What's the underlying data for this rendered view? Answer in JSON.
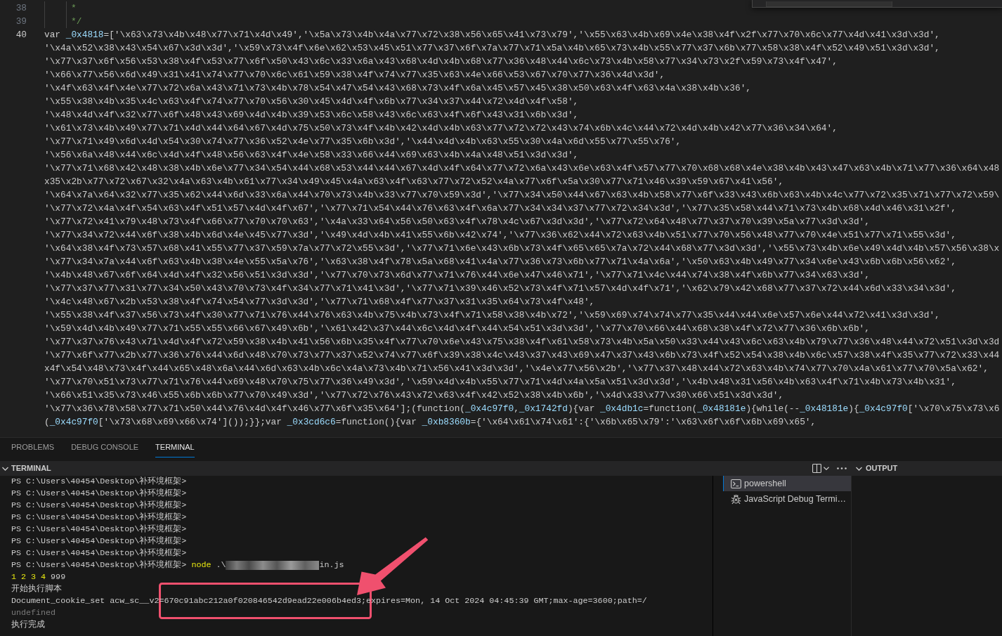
{
  "editor": {
    "lines": [
      {
        "number": "38",
        "current": false,
        "rows": [
          {
            "tokens": [
              {
                "kind": "comment",
                "text": "*"
              }
            ]
          }
        ]
      },
      {
        "number": "39",
        "current": false,
        "rows": [
          {
            "tokens": [
              {
                "kind": "comment",
                "text": "*/"
              }
            ]
          }
        ]
      },
      {
        "number": "40",
        "current": true,
        "rows": [
          {
            "tokens": [
              {
                "kind": "plain",
                "text": "var "
              },
              {
                "kind": "identifier",
                "text": "_0x4818"
              },
              {
                "kind": "plain",
                "text": "=['\\x63\\x73\\x4b\\x48\\x77\\x71\\x4d\\x49','\\x5a\\x73\\x4b\\x4a\\x77\\x72\\x38\\x56\\x65\\x41\\x73\\x79','\\x55\\x63\\x4b\\x69\\x4e\\x38\\x4f\\x2f\\x77\\x70\\x6c\\x77\\x4d\\x41\\x3d\\x3d',"
              }
            ]
          },
          {
            "tokens": [
              {
                "kind": "plain",
                "text": "'\\x4a\\x52\\x38\\x43\\x54\\x67\\x3d\\x3d','\\x59\\x73\\x4f\\x6e\\x62\\x53\\x45\\x51\\x77\\x37\\x6f\\x7a\\x77\\x71\\x5a\\x4b\\x65\\x73\\x4b\\x55\\x77\\x37\\x6b\\x77\\x58\\x38\\x4f\\x52\\x49\\x51\\x3d\\x3d',"
              }
            ]
          },
          {
            "tokens": [
              {
                "kind": "plain",
                "text": "'\\x77\\x37\\x6f\\x56\\x53\\x38\\x4f\\x53\\x77\\x6f\\x50\\x43\\x6c\\x33\\x6a\\x43\\x68\\x4d\\x4b\\x68\\x77\\x36\\x48\\x44\\x6c\\x73\\x4b\\x58\\x77\\x34\\x73\\x2f\\x59\\x73\\x4f\\x47',"
              }
            ]
          },
          {
            "tokens": [
              {
                "kind": "plain",
                "text": "'\\x66\\x77\\x56\\x6d\\x49\\x31\\x41\\x74\\x77\\x70\\x6c\\x61\\x59\\x38\\x4f\\x74\\x77\\x35\\x63\\x4e\\x66\\x53\\x67\\x70\\x77\\x36\\x4d\\x3d',"
              }
            ]
          },
          {
            "tokens": [
              {
                "kind": "plain",
                "text": "'\\x4f\\x63\\x4f\\x4e\\x77\\x72\\x6a\\x43\\x71\\x73\\x4b\\x78\\x54\\x47\\x54\\x43\\x68\\x73\\x4f\\x6a\\x45\\x57\\x45\\x38\\x50\\x63\\x4f\\x63\\x4a\\x38\\x4b\\x36',"
              }
            ]
          },
          {
            "tokens": [
              {
                "kind": "plain",
                "text": "'\\x55\\x38\\x4b\\x35\\x4c\\x63\\x4f\\x74\\x77\\x70\\x56\\x30\\x45\\x4d\\x4f\\x6b\\x77\\x34\\x37\\x44\\x72\\x4d\\x4f\\x58',"
              }
            ]
          },
          {
            "tokens": [
              {
                "kind": "plain",
                "text": "'\\x48\\x4d\\x4f\\x32\\x77\\x6f\\x48\\x43\\x69\\x4d\\x4b\\x39\\x53\\x6c\\x58\\x43\\x6c\\x63\\x4f\\x6f\\x43\\x31\\x6b\\x3d',"
              }
            ]
          },
          {
            "tokens": [
              {
                "kind": "plain",
                "text": "'\\x61\\x73\\x4b\\x49\\x77\\x71\\x4d\\x44\\x64\\x67\\x4d\\x75\\x50\\x73\\x4f\\x4b\\x42\\x4d\\x4b\\x63\\x77\\x72\\x72\\x43\\x74\\x6b\\x4c\\x44\\x72\\x4d\\x4b\\x42\\x77\\x36\\x34\\x64',"
              }
            ]
          },
          {
            "tokens": [
              {
                "kind": "plain",
                "text": "'\\x77\\x71\\x49\\x6d\\x4d\\x54\\x30\\x74\\x77\\x36\\x52\\x4e\\x77\\x35\\x6b\\x3d','\\x44\\x4d\\x4b\\x63\\x55\\x30\\x4a\\x6d\\x55\\x77\\x55\\x76',"
              }
            ]
          },
          {
            "tokens": [
              {
                "kind": "plain",
                "text": "'\\x56\\x6a\\x48\\x44\\x6c\\x4d\\x4f\\x48\\x56\\x63\\x4f\\x4e\\x58\\x33\\x66\\x44\\x69\\x63\\x4b\\x4a\\x48\\x51\\x3d\\x3d',"
              }
            ]
          },
          {
            "tokens": [
              {
                "kind": "plain",
                "text": "'\\x77\\x71\\x68\\x42\\x48\\x38\\x4b\\x6e\\x77\\x34\\x54\\x44\\x68\\x53\\x44\\x44\\x67\\x4d\\x4f\\x64\\x77\\x72\\x6a\\x43\\x6e\\x63\\x4f\\x57\\x77\\x70\\x68\\x68\\x4e\\x38\\x4b\\x43\\x47\\x63\\x4b\\x71\\x77\\x36\\x64\\x48"
              }
            ]
          },
          {
            "tokens": [
              {
                "kind": "plain",
                "text": "x35\\x2b\\x77\\x72\\x67\\x32\\x4a\\x63\\x4b\\x61\\x77\\x34\\x49\\x45\\x4a\\x63\\x4f\\x63\\x77\\x72\\x52\\x4a\\x77\\x6f\\x5a\\x30\\x77\\x71\\x46\\x39\\x59\\x67\\x41\\x56',"
              }
            ]
          },
          {
            "tokens": [
              {
                "kind": "plain",
                "text": "'\\x64\\x7a\\x64\\x32\\x77\\x35\\x62\\x44\\x6d\\x33\\x6a\\x44\\x70\\x73\\x4b\\x33\\x77\\x70\\x59\\x3d','\\x77\\x34\\x50\\x44\\x67\\x63\\x4b\\x58\\x77\\x6f\\x33\\x43\\x6b\\x63\\x4b\\x4c\\x77\\x72\\x35\\x71\\x77\\x72\\x59\\"
              }
            ]
          },
          {
            "tokens": [
              {
                "kind": "plain",
                "text": "'\\x77\\x72\\x4a\\x4f\\x54\\x63\\x4f\\x51\\x57\\x4d\\x4f\\x67','\\x77\\x71\\x54\\x44\\x76\\x63\\x4f\\x6a\\x77\\x34\\x34\\x37\\x77\\x72\\x34\\x3d','\\x77\\x35\\x58\\x44\\x71\\x73\\x4b\\x68\\x4d\\x46\\x31\\x2f',"
              }
            ]
          },
          {
            "tokens": [
              {
                "kind": "plain",
                "text": "'\\x77\\x72\\x41\\x79\\x48\\x73\\x4f\\x66\\x77\\x70\\x70\\x63','\\x4a\\x33\\x64\\x56\\x50\\x63\\x4f\\x78\\x4c\\x67\\x3d\\x3d','\\x77\\x72\\x64\\x48\\x77\\x37\\x70\\x39\\x5a\\x77\\x3d\\x3d',"
              }
            ]
          },
          {
            "tokens": [
              {
                "kind": "plain",
                "text": "'\\x77\\x34\\x72\\x44\\x6f\\x38\\x4b\\x6d\\x4e\\x45\\x77\\x3d','\\x49\\x4d\\x4b\\x41\\x55\\x6b\\x42\\x74','\\x77\\x36\\x62\\x44\\x72\\x63\\x4b\\x51\\x77\\x70\\x56\\x48\\x77\\x70\\x4e\\x51\\x77\\x71\\x55\\x3d',"
              }
            ]
          },
          {
            "tokens": [
              {
                "kind": "plain",
                "text": "'\\x64\\x38\\x4f\\x73\\x57\\x68\\x41\\x55\\x77\\x37\\x59\\x7a\\x77\\x72\\x55\\x3d','\\x77\\x71\\x6e\\x43\\x6b\\x73\\x4f\\x65\\x65\\x7a\\x72\\x44\\x68\\x77\\x3d\\x3d','\\x55\\x73\\x4b\\x6e\\x49\\x4d\\x4b\\x57\\x56\\x38\\x"
              }
            ]
          },
          {
            "tokens": [
              {
                "kind": "plain",
                "text": "'\\x77\\x34\\x7a\\x44\\x6f\\x63\\x4b\\x38\\x4e\\x55\\x5a\\x76','\\x63\\x38\\x4f\\x78\\x5a\\x68\\x41\\x4a\\x77\\x36\\x73\\x6b\\x77\\x71\\x4a\\x6a','\\x50\\x63\\x4b\\x49\\x77\\x34\\x6e\\x43\\x6b\\x6b\\x56\\x62',"
              }
            ]
          },
          {
            "tokens": [
              {
                "kind": "plain",
                "text": "'\\x4b\\x48\\x67\\x6f\\x64\\x4d\\x4f\\x32\\x56\\x51\\x3d\\x3d','\\x77\\x70\\x73\\x6d\\x77\\x71\\x76\\x44\\x6e\\x47\\x46\\x71','\\x77\\x71\\x4c\\x44\\x74\\x38\\x4f\\x6b\\x77\\x34\\x63\\x3d',"
              }
            ]
          },
          {
            "tokens": [
              {
                "kind": "plain",
                "text": "'\\x77\\x37\\x77\\x31\\x77\\x34\\x50\\x43\\x70\\x73\\x4f\\x34\\x77\\x71\\x41\\x3d','\\x77\\x71\\x39\\x46\\x52\\x73\\x4f\\x71\\x57\\x4d\\x4f\\x71','\\x62\\x79\\x42\\x68\\x77\\x37\\x72\\x44\\x6d\\x33\\x34\\x3d',"
              }
            ]
          },
          {
            "tokens": [
              {
                "kind": "plain",
                "text": "'\\x4c\\x48\\x67\\x2b\\x53\\x38\\x4f\\x74\\x54\\x77\\x3d\\x3d','\\x77\\x71\\x68\\x4f\\x77\\x37\\x31\\x35\\x64\\x73\\x4f\\x48',"
              }
            ]
          },
          {
            "tokens": [
              {
                "kind": "plain",
                "text": "'\\x55\\x38\\x4f\\x37\\x56\\x73\\x4f\\x30\\x77\\x71\\x76\\x44\\x76\\x63\\x4b\\x75\\x4b\\x73\\x4f\\x71\\x58\\x38\\x4b\\x72','\\x59\\x69\\x74\\x74\\x77\\x35\\x44\\x44\\x6e\\x57\\x6e\\x44\\x72\\x41\\x3d\\x3d',"
              }
            ]
          },
          {
            "tokens": [
              {
                "kind": "plain",
                "text": "'\\x59\\x4d\\x4b\\x49\\x77\\x71\\x55\\x55\\x66\\x67\\x49\\x6b','\\x61\\x42\\x37\\x44\\x6c\\x4d\\x4f\\x44\\x54\\x51\\x3d\\x3d','\\x77\\x70\\x66\\x44\\x68\\x38\\x4f\\x72\\x77\\x36\\x6b\\x6b',"
              }
            ]
          },
          {
            "tokens": [
              {
                "kind": "plain",
                "text": "'\\x77\\x37\\x76\\x43\\x71\\x4d\\x4f\\x72\\x59\\x38\\x4b\\x41\\x56\\x6b\\x35\\x4f\\x77\\x70\\x6e\\x43\\x75\\x38\\x4f\\x61\\x58\\x73\\x4b\\x5a\\x50\\x33\\x44\\x43\\x6c\\x63\\x4b\\x79\\x77\\x36\\x48\\x44\\x72\\x51\\x3d\\x3d"
              }
            ]
          },
          {
            "tokens": [
              {
                "kind": "plain",
                "text": "'\\x77\\x6f\\x77\\x2b\\x77\\x36\\x76\\x44\\x6d\\x48\\x70\\x73\\x77\\x37\\x52\\x74\\x77\\x6f\\x39\\x38\\x4c\\x43\\x37\\x43\\x69\\x47\\x37\\x43\\x6b\\x73\\x4f\\x52\\x54\\x38\\x4b\\x6c\\x57\\x38\\x4f\\x35\\x77\\x72\\x33\\x44"
              }
            ]
          },
          {
            "tokens": [
              {
                "kind": "plain",
                "text": "x4f\\x54\\x48\\x73\\x4f\\x44\\x65\\x48\\x6a\\x44\\x6d\\x63\\x4b\\x6c\\x4a\\x73\\x4b\\x71\\x56\\x41\\x3d\\x3d','\\x4e\\x77\\x56\\x2b','\\x77\\x37\\x48\\x44\\x72\\x63\\x4b\\x74\\x77\\x70\\x4a\\x61\\x77\\x70\\x5a\\x62',"
              }
            ]
          },
          {
            "tokens": [
              {
                "kind": "plain",
                "text": "'\\x77\\x70\\x51\\x73\\x77\\x71\\x76\\x44\\x69\\x48\\x70\\x75\\x77\\x36\\x49\\x3d','\\x59\\x4d\\x4b\\x55\\x77\\x71\\x4d\\x4a\\x5a\\x51\\x3d\\x3d','\\x4b\\x48\\x31\\x56\\x4b\\x63\\x4f\\x71\\x4b\\x73\\x4b\\x31',"
              }
            ]
          },
          {
            "tokens": [
              {
                "kind": "plain",
                "text": "'\\x66\\x51\\x35\\x73\\x46\\x55\\x6b\\x6b\\x77\\x70\\x49\\x3d','\\x77\\x72\\x76\\x43\\x72\\x63\\x4f\\x42\\x52\\x38\\x4b\\x6b','\\x4d\\x33\\x77\\x30\\x66\\x51\\x3d\\x3d',"
              }
            ]
          },
          {
            "tokens": [
              {
                "kind": "plain",
                "text": "'\\x77\\x36\\x78\\x58\\x77\\x71\\x50\\x44\\x76\\x4d\\x4f\\x46\\x77\\x6f\\x35\\x64'];(function("
              },
              {
                "kind": "identifier",
                "text": "_0x4c97f0"
              },
              {
                "kind": "plain",
                "text": ","
              },
              {
                "kind": "identifier",
                "text": "_0x1742fd"
              },
              {
                "kind": "plain",
                "text": "){var "
              },
              {
                "kind": "identifier",
                "text": "_0x4db1c"
              },
              {
                "kind": "plain",
                "text": "=function("
              },
              {
                "kind": "identifier",
                "text": "_0x48181e"
              },
              {
                "kind": "plain",
                "text": "){while(--"
              },
              {
                "kind": "identifier",
                "text": "_0x48181e"
              },
              {
                "kind": "plain",
                "text": "){"
              },
              {
                "kind": "identifier",
                "text": "_0x4c97f0"
              },
              {
                "kind": "plain",
                "text": "['\\x70\\x75\\x73\\x6"
              }
            ]
          },
          {
            "tokens": [
              {
                "kind": "plain",
                "text": "("
              },
              {
                "kind": "identifier",
                "text": "_0x4c97f0"
              },
              {
                "kind": "plain",
                "text": "['\\x73\\x68\\x69\\x66\\x74']());}};var "
              },
              {
                "kind": "identifier",
                "text": "_0x3cd6c6"
              },
              {
                "kind": "plain",
                "text": "=function(){var "
              },
              {
                "kind": "identifier",
                "text": "_0xb8360b"
              },
              {
                "kind": "plain",
                "text": "={'\\x64\\x61\\x74\\x61':{'\\x6b\\x65\\x79':'\\x63\\x6f\\x6f\\x6b\\x69\\x65',"
              }
            ]
          }
        ]
      }
    ]
  },
  "panel": {
    "tabs": [
      {
        "label": "PROBLEMS",
        "selected": false
      },
      {
        "label": "DEBUG CONSOLE",
        "selected": false
      },
      {
        "label": "TERMINAL",
        "selected": true
      }
    ],
    "terminal_header": {
      "title": "TERMINAL",
      "expanded": true
    },
    "output_header": {
      "title": "OUTPUT",
      "expanded": true
    }
  },
  "terminal": {
    "lines": [
      {
        "kind": "prompt",
        "prompt": "PS C:\\Users\\40454\\Desktop\\补环境框架>"
      },
      {
        "kind": "prompt",
        "prompt": "PS C:\\Users\\40454\\Desktop\\补环境框架>"
      },
      {
        "kind": "prompt",
        "prompt": "PS C:\\Users\\40454\\Desktop\\补环境框架>"
      },
      {
        "kind": "prompt",
        "prompt": "PS C:\\Users\\40454\\Desktop\\补环境框架>"
      },
      {
        "kind": "prompt",
        "prompt": "PS C:\\Users\\40454\\Desktop\\补环境框架>"
      },
      {
        "kind": "prompt",
        "prompt": "PS C:\\Users\\40454\\Desktop\\补环境框架>"
      },
      {
        "kind": "prompt",
        "prompt": "PS C:\\Users\\40454\\Desktop\\补环境框架>"
      },
      {
        "kind": "command",
        "prompt": "PS C:\\Users\\40454\\Desktop\\补环境框架>",
        "command": "node",
        "path_start": ".\\",
        "path_end": "in.js"
      },
      {
        "kind": "numbers",
        "numbers": "1 2 3 4",
        "text": "999"
      },
      {
        "kind": "output",
        "text": "开始执行脚本"
      },
      {
        "kind": "output",
        "text": "Document_cookie_set acw_sc__v2=670c91abc212a0f020846542d9ead22e006b4ed3;expires=Mon, 14 Oct 2024 04:45:39 GMT;max-age=3600;path=/"
      },
      {
        "kind": "muted",
        "text": "undefined"
      },
      {
        "kind": "output",
        "text": "执行完成"
      }
    ],
    "sessions": [
      {
        "kind": "shell",
        "name": "powershell",
        "selected": true
      },
      {
        "kind": "debug",
        "name": "JavaScript Debug Termi…",
        "selected": false
      }
    ]
  }
}
